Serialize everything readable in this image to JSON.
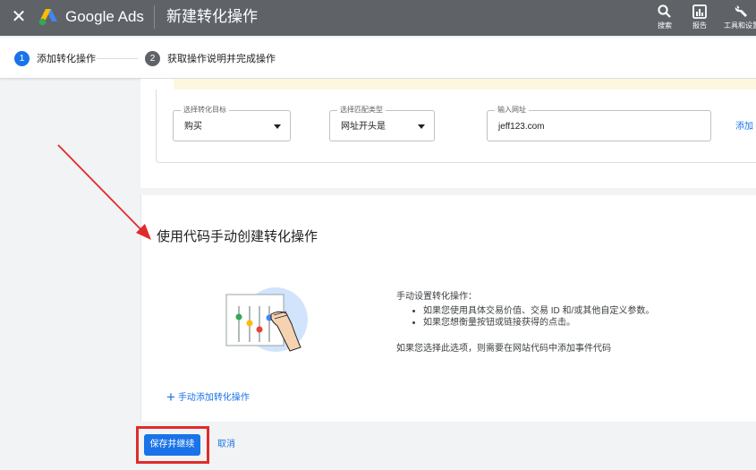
{
  "header": {
    "brand": "Google Ads",
    "title": "新建转化操作",
    "tools": [
      {
        "icon": "search-icon",
        "label": "搜索"
      },
      {
        "icon": "reports-icon",
        "label": "报告"
      },
      {
        "icon": "wrench-icon",
        "label": "工具和设置"
      }
    ]
  },
  "stepper": {
    "steps": [
      {
        "number": "1",
        "label": "添加转化操作",
        "state": "active"
      },
      {
        "number": "2",
        "label": "获取操作说明并完成操作",
        "state": "inactive"
      }
    ]
  },
  "form": {
    "goal": {
      "label": "选择转化目标",
      "value": "购买"
    },
    "match_type": {
      "label": "选择匹配类型",
      "value": "网址开头是"
    },
    "url": {
      "label": "输入网址",
      "value": "jeff123.com"
    },
    "add_link": "添加"
  },
  "manual": {
    "title": "使用代码手动创建转化操作",
    "description": "手动设置转化操作：",
    "bullets": [
      "如果您使用具体交易价值、交易 ID 和/或其他自定义参数。",
      "如果您想衡量按钮或链接获得的点击。"
    ],
    "note": "如果您选择此选项，则需要在网站代码中添加事件代码",
    "add_link": "手动添加转化操作"
  },
  "actions": {
    "save": "保存并继续",
    "cancel": "取消"
  },
  "colors": {
    "topbar": "#5f6368",
    "accent": "#1a73e8",
    "annotation": "#e12b2b"
  }
}
